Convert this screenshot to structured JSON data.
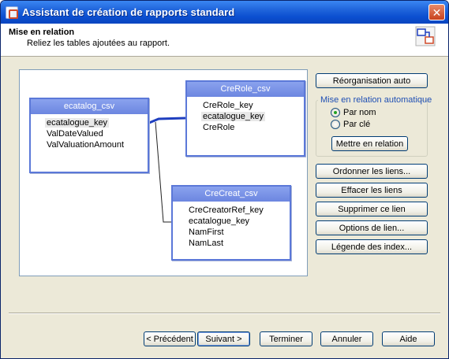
{
  "window": {
    "title": "Assistant de création de rapports standard"
  },
  "header": {
    "title": "Mise en relation",
    "subtitle": "Reliez les tables ajoutées au rapport."
  },
  "tables": {
    "ecatalog": {
      "title": "ecatalog_csv",
      "fields": [
        "ecatalogue_key",
        "ValDateValued",
        "ValValuationAmount"
      ],
      "selected": "ecatalogue_key"
    },
    "crerole": {
      "title": "CreRole_csv",
      "fields": [
        "CreRole_key",
        "ecatalogue_key",
        "CreRole"
      ],
      "selected": "ecatalogue_key"
    },
    "crecreat": {
      "title": "CreCreat_csv",
      "fields": [
        "CreCreatorRef_key",
        "ecatalogue_key",
        "NamFirst",
        "NamLast"
      ]
    }
  },
  "side": {
    "reorg": "Réorganisation auto",
    "auto_group": "Mise en relation automatique",
    "radio_name": "Par nom",
    "radio_key": "Par clé",
    "radio_selected": "name",
    "link_btn": "Mettre en relation",
    "order_links": "Ordonner les liens...",
    "clear_links": "Effacer les liens",
    "delete_link": "Supprimer ce lien",
    "link_options": "Options de lien...",
    "index_legend": "Légende des index..."
  },
  "footer": {
    "prev": "< Précédent",
    "next": "Suivant >",
    "finish": "Terminer",
    "cancel": "Annuler",
    "help": "Aide"
  },
  "colors": {
    "titlebar": "#0b4fd0",
    "table_header": "#6c86e0",
    "link_line": "#1f3fbf"
  }
}
